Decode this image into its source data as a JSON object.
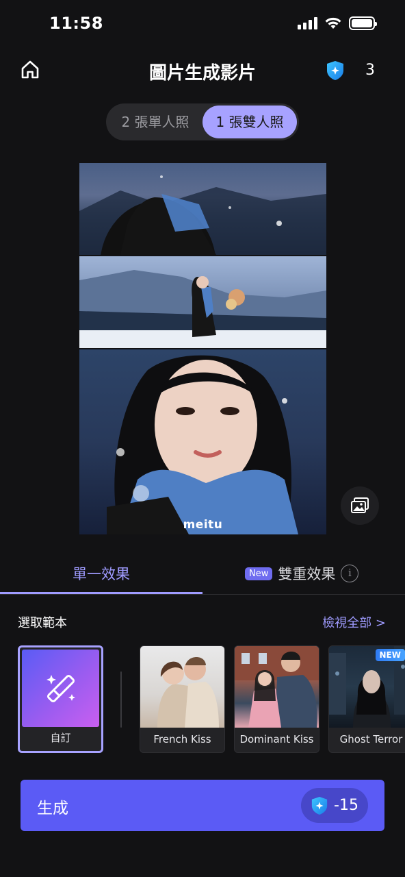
{
  "status_bar": {
    "time": "11:58"
  },
  "header": {
    "title": "圖片生成影片",
    "credits": "3"
  },
  "mode_toggle": {
    "options": [
      "2 張單人照",
      "1 張雙人照"
    ],
    "selected": 1
  },
  "preview": {
    "watermark": "meitu"
  },
  "tabs": {
    "single": "單一效果",
    "double": "雙重效果",
    "double_badge": "New",
    "info": "i"
  },
  "templates": {
    "section_title": "選取範本",
    "view_all": "檢視全部 >",
    "items": [
      {
        "label": "自訂",
        "icon": "magic-wand-icon",
        "selected": true
      },
      {
        "label": "French Kiss"
      },
      {
        "label": "Dominant Kiss"
      },
      {
        "label": "Ghost Terror",
        "badge": "NEW"
      }
    ]
  },
  "generate": {
    "label": "生成",
    "cost": "-15"
  },
  "colors": {
    "accent": "#a7a2ff",
    "primary_button": "#5b5bf5",
    "background": "#121214"
  }
}
